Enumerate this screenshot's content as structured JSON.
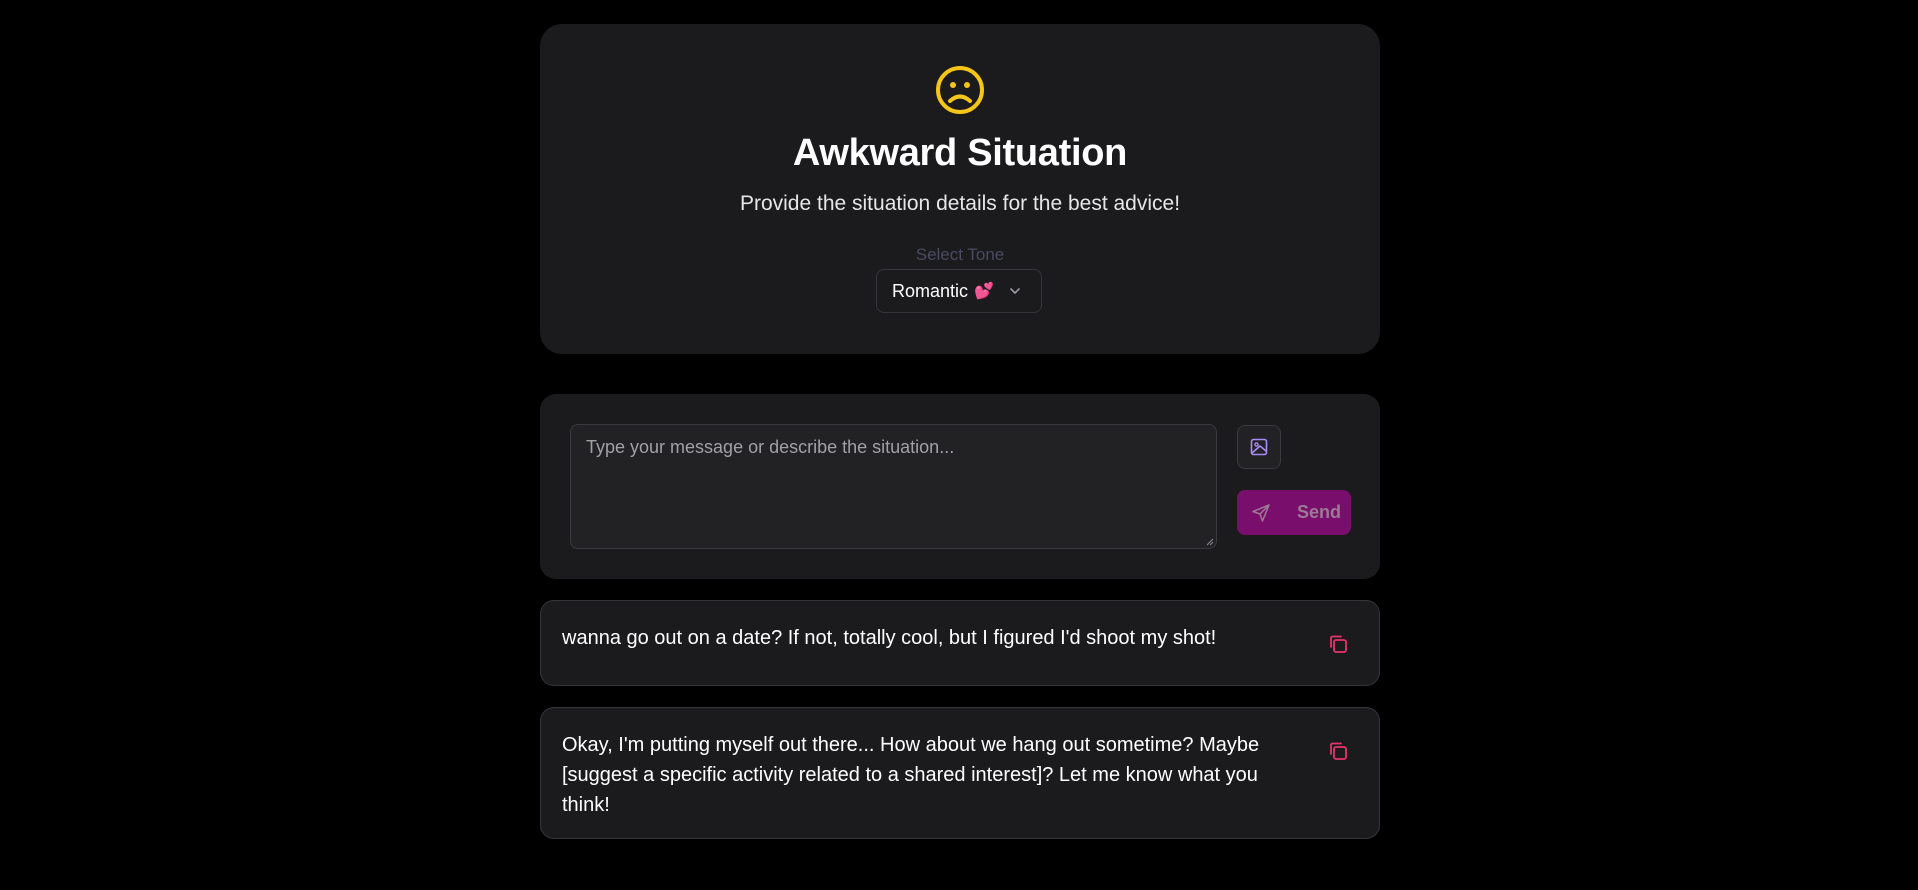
{
  "header": {
    "icon": "frown-icon",
    "icon_color": "#f5c518",
    "title": "Awkward Situation",
    "subtitle": "Provide the situation details for the best advice!",
    "tone_label": "Select Tone",
    "tone_selected": "Romantic",
    "tone_emoji": "💕"
  },
  "composer": {
    "placeholder": "Type your message or describe the situation...",
    "image_button_icon": "image-icon",
    "send_label": "Send",
    "send_icon": "send-icon",
    "accent": "#7a0e6c"
  },
  "replies": [
    {
      "text": "wanna go out on a date? If not, totally cool, but I figured I'd shoot my shot!",
      "icon": "copy-icon"
    },
    {
      "text": "Okay, I'm putting myself out there... How about we hang out sometime? Maybe [suggest a specific activity related to a shared interest]? Let me know what you think!",
      "icon": "copy-icon"
    }
  ],
  "colors": {
    "background": "#000000",
    "card": "#1b1b1d",
    "copy_icon": "#e8336b"
  }
}
